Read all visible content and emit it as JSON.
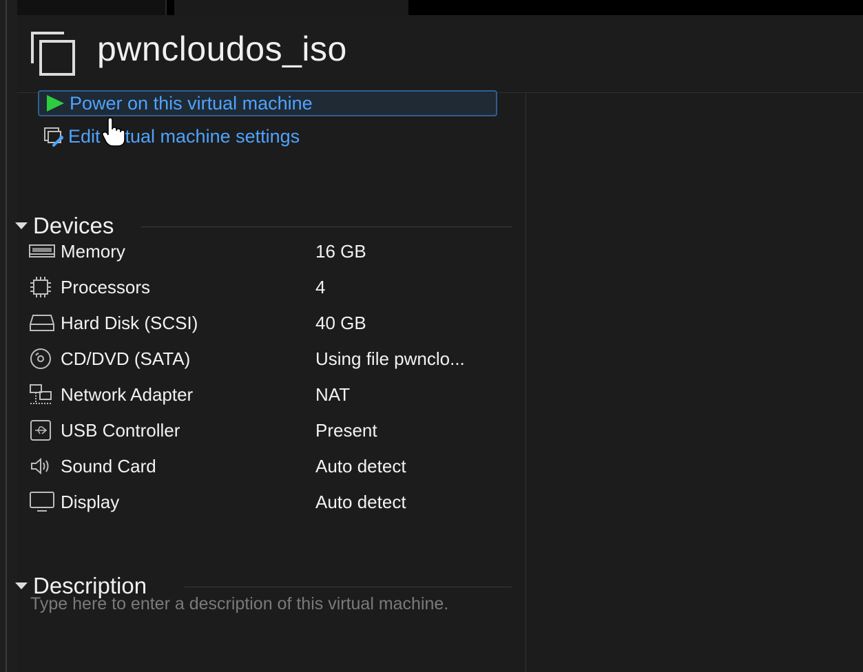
{
  "vm": {
    "title": "pwncloudos_iso"
  },
  "commands": {
    "power_on": "Power on this virtual machine",
    "edit_settings": "Edit virtual machine settings"
  },
  "devices": {
    "header": "Devices",
    "items": [
      {
        "name": "Memory",
        "value": "16 GB",
        "icon": "memory-icon"
      },
      {
        "name": "Processors",
        "value": "4",
        "icon": "processor-icon"
      },
      {
        "name": "Hard Disk (SCSI)",
        "value": "40 GB",
        "icon": "hard-disk-icon"
      },
      {
        "name": "CD/DVD (SATA)",
        "value": "Using file pwnclo...",
        "icon": "cd-dvd-icon"
      },
      {
        "name": "Network Adapter",
        "value": "NAT",
        "icon": "network-adapter-icon"
      },
      {
        "name": "USB Controller",
        "value": "Present",
        "icon": "usb-icon"
      },
      {
        "name": "Sound Card",
        "value": "Auto detect",
        "icon": "speaker-icon"
      },
      {
        "name": "Display",
        "value": "Auto detect",
        "icon": "monitor-icon"
      }
    ]
  },
  "description": {
    "header": "Description",
    "placeholder": "Type here to enter a description of this virtual machine."
  },
  "colors": {
    "link": "#4ea3ff",
    "power_green": "#2ecc40",
    "background": "#1c1c1c"
  }
}
